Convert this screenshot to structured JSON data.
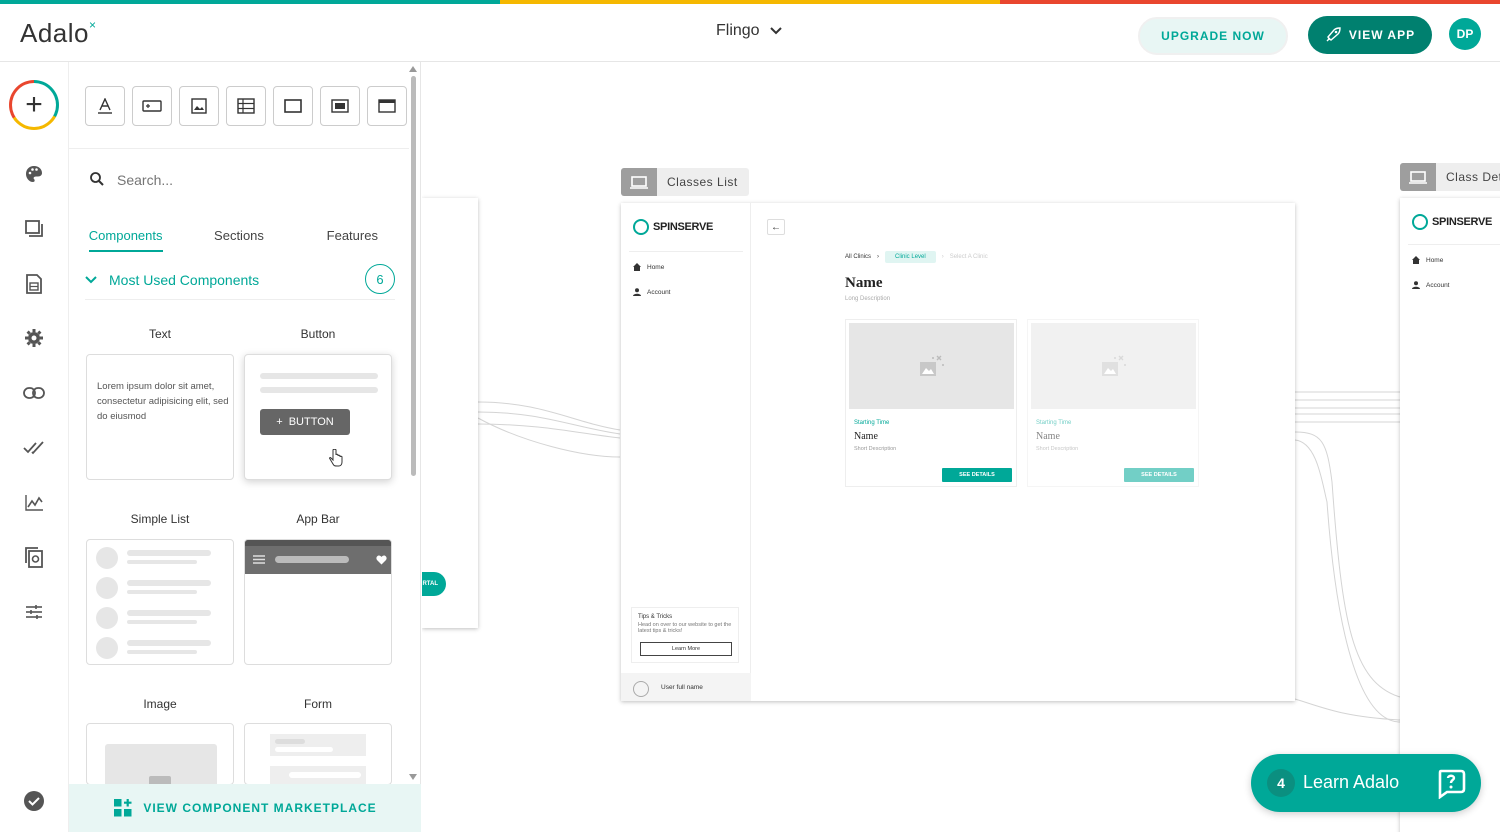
{
  "brand": {
    "logo": "Adalo",
    "colors": {
      "teal": "#00a898",
      "dark_teal": "#00806f",
      "yellow": "#f5b800",
      "red": "#e9462e"
    }
  },
  "header": {
    "app_name": "Flingo",
    "upgrade_label": "UPGRADE NOW",
    "view_app_label": "VIEW APP",
    "avatar_initials": "DP"
  },
  "left_nav": {
    "icons": [
      "add-icon",
      "palette-icon",
      "screens-icon",
      "database-icon",
      "gear-icon",
      "link-icon",
      "double-check-icon",
      "analytics-icon",
      "publish-icon",
      "sliders-icon",
      "verified-icon"
    ]
  },
  "panel": {
    "tools": [
      "text-tool-icon",
      "button-tool-icon",
      "image-tool-icon",
      "list-tool-icon",
      "rectangle-tool-icon",
      "form-tool-icon",
      "appbar-tool-icon"
    ],
    "search": {
      "placeholder": "Search..."
    },
    "tabs": [
      "Components",
      "Sections",
      "Features"
    ],
    "section": {
      "title": "Most Used Components",
      "count": "6"
    },
    "components": [
      {
        "label": "Text",
        "preview_text": "Lorem ipsum dolor sit amet, consectetur adipisicing elit, sed do eiusmod"
      },
      {
        "label": "Button",
        "button_text": "BUTTON"
      },
      {
        "label": "Simple List"
      },
      {
        "label": "App Bar"
      },
      {
        "label": "Image"
      },
      {
        "label": "Form"
      }
    ],
    "marketplace_label": "VIEW COMPONENT MARKETPLACE"
  },
  "canvas": {
    "partial_button_text": "RTAL",
    "screen1": {
      "label": "Classes List",
      "logo": "SPINSERVE",
      "nav": [
        "Home",
        "Account"
      ],
      "tips_title": "Tips & Tricks",
      "tips_body": "Head on over to our website to get the latest tips & tricks!",
      "learn_more": "Learn More",
      "user_name": "User full name",
      "breadcrumb": [
        "All Clinics",
        "Clinic Level",
        "Select A Clinic"
      ],
      "title": "Name",
      "description": "Long Description",
      "cards": [
        {
          "starting": "Starting Time",
          "name": "Name",
          "desc": "Short Description",
          "button": "SEE DETAILS"
        },
        {
          "starting": "Starting Time",
          "name": "Name",
          "desc": "Short Description",
          "button": "SEE DETAILS"
        }
      ]
    },
    "screen2": {
      "label": "Class Det",
      "logo": "SPINSERVE",
      "nav": [
        "Home",
        "Account"
      ]
    }
  },
  "learn_adalo": {
    "count": "4",
    "label": "Learn Adalo"
  }
}
